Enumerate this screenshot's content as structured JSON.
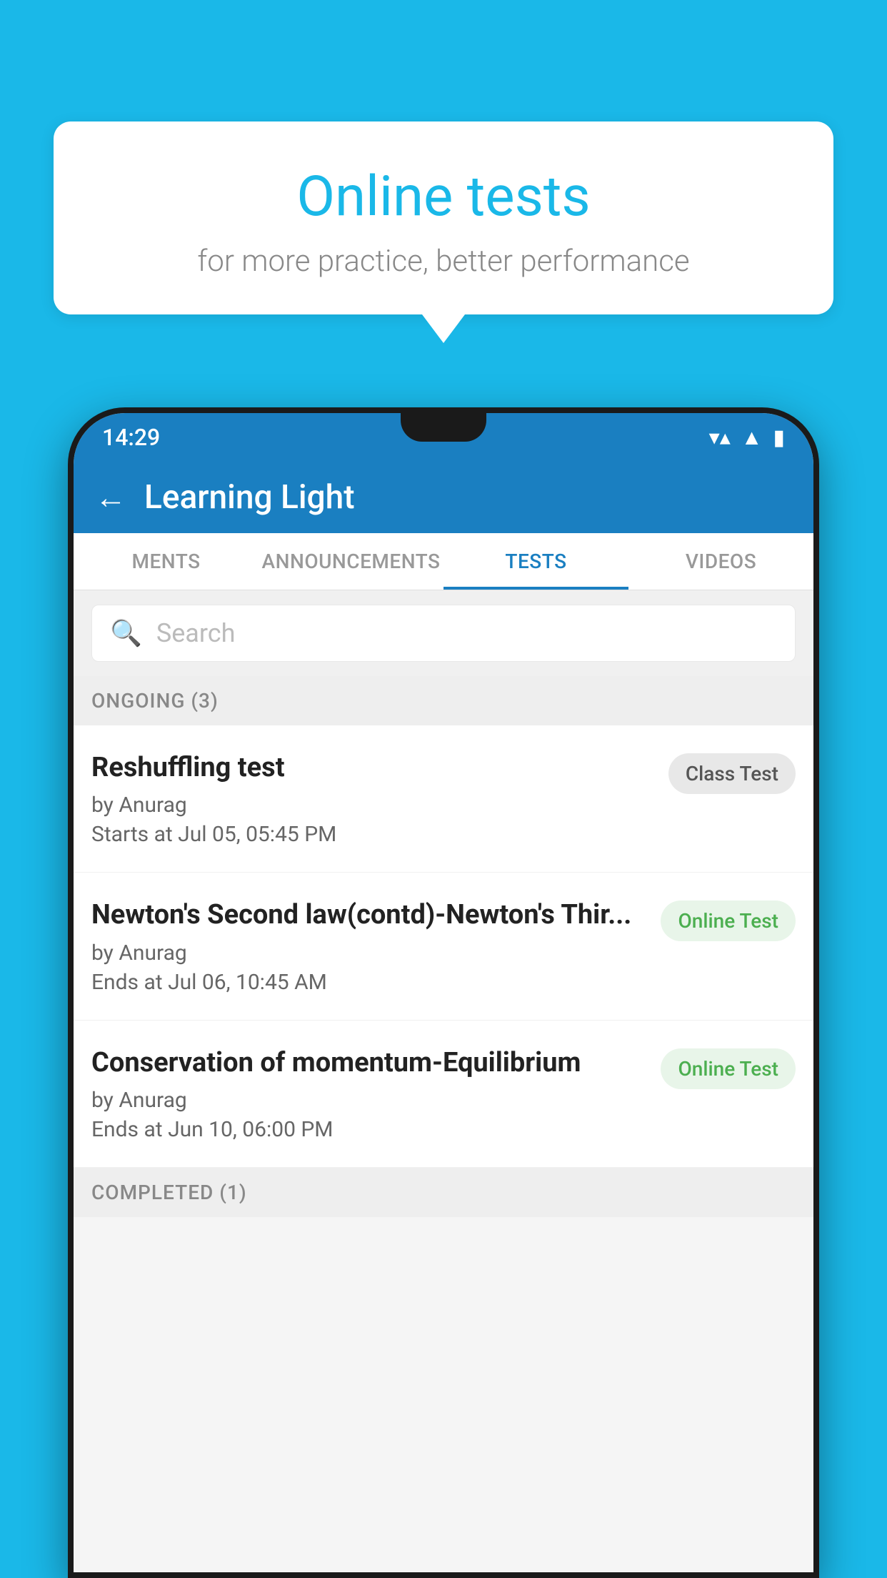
{
  "background": {
    "color": "#1ab8e8"
  },
  "speech_bubble": {
    "title": "Online tests",
    "subtitle": "for more practice, better performance"
  },
  "status_bar": {
    "time": "14:29",
    "wifi_icon": "▼",
    "signal_icon": "▲",
    "battery_icon": "▪"
  },
  "app_bar": {
    "back_label": "←",
    "title": "Learning Light"
  },
  "tabs": [
    {
      "label": "MENTS",
      "active": false
    },
    {
      "label": "ANNOUNCEMENTS",
      "active": false
    },
    {
      "label": "TESTS",
      "active": true
    },
    {
      "label": "VIDEOS",
      "active": false
    }
  ],
  "search": {
    "placeholder": "Search"
  },
  "sections": [
    {
      "header": "ONGOING (3)",
      "items": [
        {
          "title": "Reshuffling test",
          "author": "by Anurag",
          "date_label": "Starts at",
          "date": "Jul 05, 05:45 PM",
          "badge": "Class Test",
          "badge_type": "class"
        },
        {
          "title": "Newton's Second law(contd)-Newton's Thir...",
          "author": "by Anurag",
          "date_label": "Ends at",
          "date": "Jul 06, 10:45 AM",
          "badge": "Online Test",
          "badge_type": "online"
        },
        {
          "title": "Conservation of momentum-Equilibrium",
          "author": "by Anurag",
          "date_label": "Ends at",
          "date": "Jun 10, 06:00 PM",
          "badge": "Online Test",
          "badge_type": "online"
        }
      ]
    }
  ],
  "completed_header": "COMPLETED (1)"
}
